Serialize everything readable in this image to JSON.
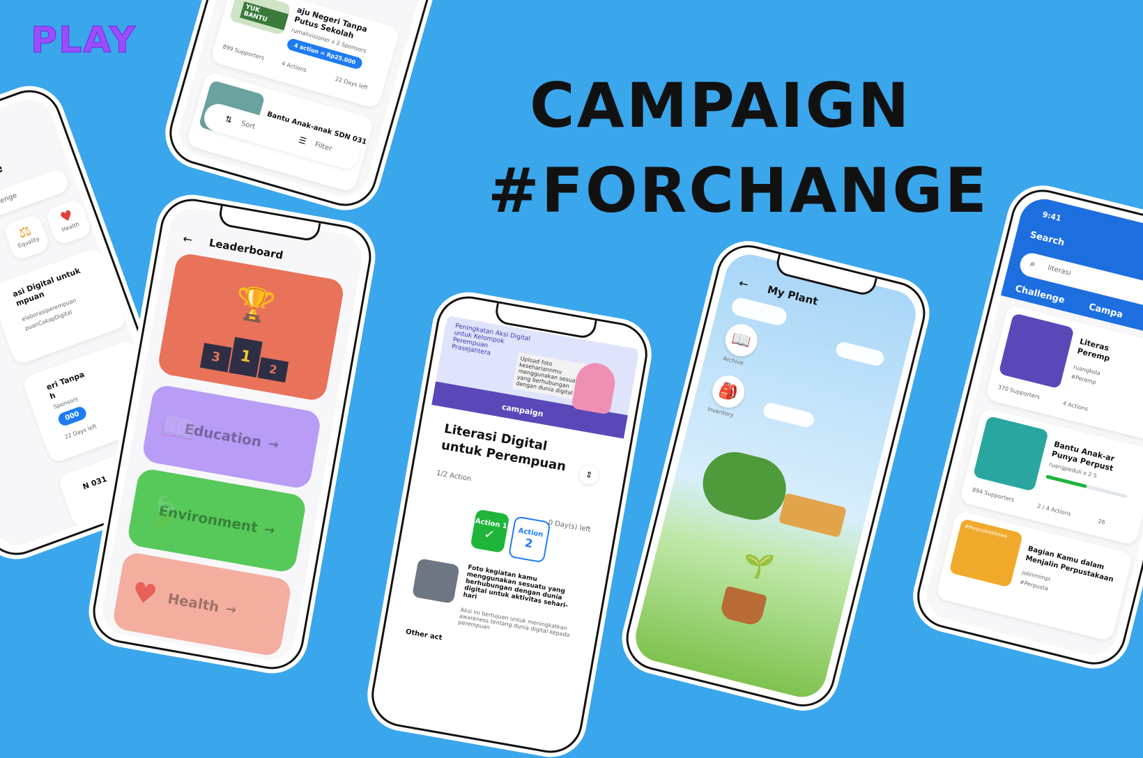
{
  "brand": "PLAY",
  "headline": {
    "line1": "CAMPAIGN",
    "line2": "#FORCHANGE"
  },
  "phone_challenge": {
    "title": "nge",
    "search_placeholder": "Challenge",
    "categories": [
      "Equality",
      "Health"
    ],
    "card1_title_a": "asi Digital untuk",
    "card1_title_b": "mpuan",
    "card1_tag_a": "elaborasiperempuan",
    "card1_tag_b": "puanCakapDigital",
    "card2_title_a": "eri Tanpa",
    "card2_title_b": "h",
    "card2_sponsors": "Sponsors",
    "card2_pill": "000",
    "card2_days": "22 Days left",
    "card3_title": "N 031"
  },
  "phone_list": {
    "card1_title_a": "aju Negeri Tanpa",
    "card1_title_b": "Putus Sekolah",
    "card1_owner": "rumahvisioner x 2 Sponsors",
    "card1_pill": "4 action = Rp25.000",
    "card1_supporters": "899 Supporters",
    "card1_actions": "4 Actions",
    "card1_days": "22 Days left",
    "card1_thumb": "YUK BANTU",
    "card2_title": "Bantu Anak-anak SDN 031",
    "sort_label": "Sort",
    "filter_label": "Filter"
  },
  "phone_leaderboard": {
    "title": "Leaderboard",
    "podium": [
      "3",
      "1",
      "2"
    ],
    "categories": [
      "Education",
      "Environment",
      "Health"
    ],
    "colors": {
      "education": "#b89cf5",
      "environment": "#56c95a",
      "health": "#f4aea0",
      "equality": "#f7d46b",
      "trophy_bg": "#e8735a"
    }
  },
  "phone_campaign": {
    "banner_title": "Peningkatan Aksi Digital untuk Kelompok Perempuan Prasejahtera",
    "banner_note": "Upload foto kesehariannmu menggunakan sesuatu yang berhubungan dengan dunia digital",
    "banner_logo": "campaign",
    "title_a": "Literasi Digital",
    "title_b": "untuk Perempuan",
    "progress": "1/2 Action",
    "days_left": "0 Day(s) left",
    "action1": "Action 1",
    "action2_label": "Action",
    "action2_num": "2",
    "task_title": "Foto kegiatan kamu menggunakan sesuatu yang berhubungan dengan dunia digital untuk aktivitas sehari-hari",
    "task_desc": "Aksi ini bertujuan untuk meningkatkan awareness tentang dunia digital kepada perempuan",
    "other": "Other act"
  },
  "phone_plant": {
    "title": "My Plant",
    "archive": "Archive",
    "inventory": "Inventory"
  },
  "phone_search": {
    "time": "9:41",
    "title": "Search",
    "query": "literasi",
    "tabs": [
      "Challenge",
      "Campa"
    ],
    "card1_title_a": "Literas",
    "card1_title_b": "Peremp",
    "card1_owner": "ruangkola",
    "card1_tag": "#Peremp",
    "card1_supporters": "370 Supporters",
    "card1_actions": "4 Actions",
    "card2_title_a": "Bantu Anak-ar",
    "card2_title_b": "Punya Perpust",
    "card2_owner": "ruangpeduli x 2 S",
    "card2_supporters": "894 Supporters",
    "card2_actions": "2 / 4 Actions",
    "card2_days": "26",
    "card3_title_a": "Bagian Kamu dalam",
    "card3_title_b": "Menjalin Perpustakaan",
    "card3_owner": "jolinmimpi",
    "card3_tag": "#Perpusta",
    "card3_thumb": "#PerpuskitaSiswa"
  }
}
